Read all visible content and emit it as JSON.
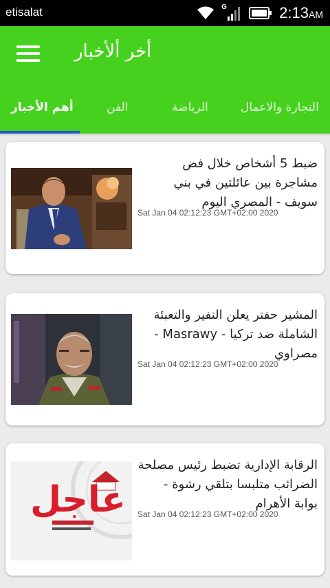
{
  "status_bar": {
    "carrier": "etisalat",
    "time": "2:13",
    "ampm": "AM",
    "signal_label": "G"
  },
  "app_bar": {
    "title": "أخر ألأخبار"
  },
  "tabs": [
    {
      "label": "التجارة والاعمال",
      "active": false
    },
    {
      "label": "الرياضة",
      "active": false
    },
    {
      "label": "الفن",
      "active": false
    },
    {
      "label": "أهم الأخبار",
      "active": true
    }
  ],
  "articles": [
    {
      "title": "ضبط 5 أشخاص خلال فض مشاجرة بين عائلتين في بني سويف - المصري اليوم",
      "date": "Sat Jan 04 02:12:23 GMT+02:00 2020"
    },
    {
      "title": "المشير حفتر يعلن النفير والتعبئة الشاملة ضد تركيا - Masrawy - مصراوي",
      "date": "Sat Jan 04 02:12:23 GMT+02:00 2020"
    },
    {
      "title": "الرقابة الإدارية تضبط رئيس مصلحة الضرائب متلبسا بتلقي رشوة - بوابة الأهرام",
      "date": "Sat Jan 04 02:12:23 GMT+02:00 2020",
      "thumb_text": "عاجل"
    }
  ],
  "colors": {
    "app_bar": "#45d11d",
    "tab_indicator": "#1f5cc4",
    "breaking_red": "#d81e2a"
  }
}
